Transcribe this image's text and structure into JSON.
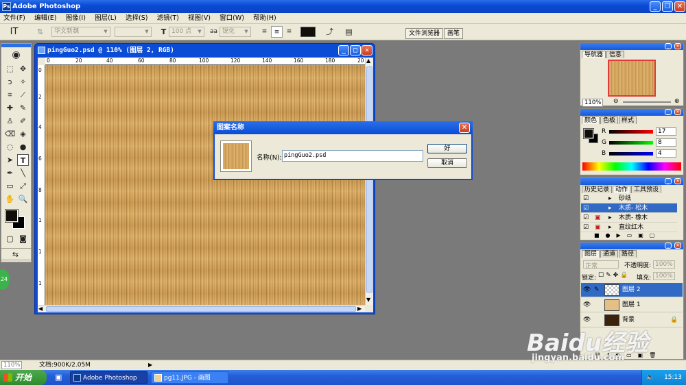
{
  "app": {
    "title": "Adobe Photoshop",
    "icon": "ps-icon"
  },
  "menu": [
    "文件(F)",
    "编辑(E)",
    "图像(I)",
    "图层(L)",
    "选择(S)",
    "滤镜(T)",
    "视图(V)",
    "窗口(W)",
    "帮助(H)"
  ],
  "options": {
    "font_family": "华文新魏",
    "font_size": "100 点",
    "antialias": "锐化",
    "text_color": "#110d08",
    "tab_file_browser": "文件浏览器",
    "tab_brushes": "画笔"
  },
  "document": {
    "title": "pingGuo2.psd @ 110% (图层 2, RGB)",
    "ruler_marks": [
      "0",
      "20",
      "40",
      "60",
      "80",
      "100",
      "120",
      "140",
      "160",
      "180",
      "20"
    ],
    "ruler_v_marks": [
      "0",
      "2",
      "4",
      "6",
      "8",
      "1",
      "1",
      "1"
    ]
  },
  "dialog": {
    "title": "图案名称",
    "name_label": "名称(N):",
    "name_value": "pingGuo2.psd",
    "ok_label": "好",
    "cancel_label": "取消"
  },
  "navigator": {
    "tabs": [
      "导航器",
      "信息"
    ],
    "zoom": "110%"
  },
  "color_panel": {
    "tabs": [
      "颜色",
      "色板",
      "样式"
    ],
    "r": {
      "label": "R",
      "value": "17"
    },
    "g": {
      "label": "G",
      "value": "8"
    },
    "b": {
      "label": "B",
      "value": "4"
    }
  },
  "actions_panel": {
    "tabs": [
      "历史记录",
      "动作",
      "工具预设"
    ],
    "items": [
      "砂纸",
      "木质- 松木",
      "木质- 橡木",
      "直纹红木"
    ]
  },
  "layers_panel": {
    "tabs": [
      "图层",
      "通道",
      "路径"
    ],
    "blend_mode": "正常",
    "opacity_label": "不透明度:",
    "opacity_value": "100%",
    "lock_label": "锁定:",
    "fill_label": "填充:",
    "fill_value": "100%",
    "layers": [
      {
        "name": "图层 2",
        "selected": true
      },
      {
        "name": "图层 1",
        "selected": false
      },
      {
        "name": "背景",
        "selected": false
      }
    ]
  },
  "status": {
    "zoom": "110%",
    "doc_info": "文档:900K/2.05M"
  },
  "taskbar": {
    "start_label": "开始",
    "tasks": [
      "Adobe Photoshop",
      "pg11.JPG - 画图"
    ],
    "clock": "15:13"
  },
  "watermark": {
    "brand": "Baidu经验",
    "url": "jingyan.baidu.com"
  },
  "side_badge": "24"
}
